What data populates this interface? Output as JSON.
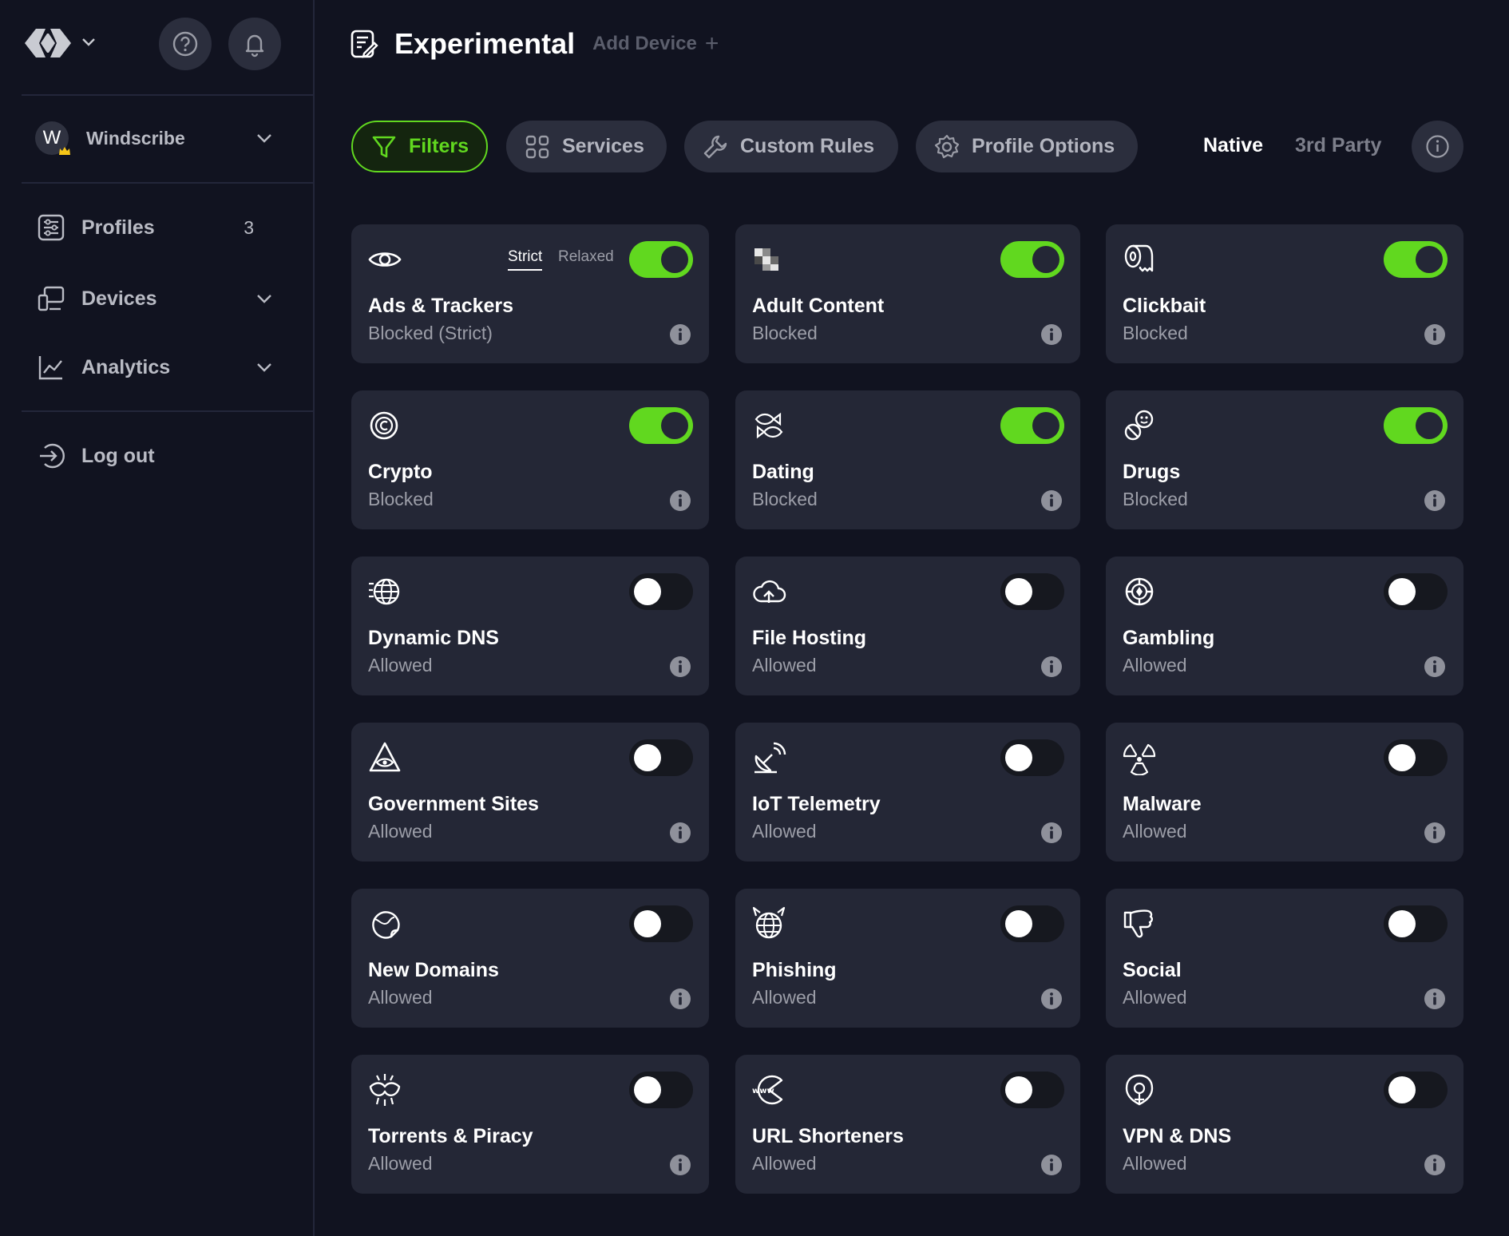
{
  "header": {
    "title": "Experimental",
    "add_device_label": "Add Device",
    "add_device_plus": "+"
  },
  "sidebar": {
    "account": {
      "initial": "W",
      "name": "Windscribe"
    },
    "items": [
      {
        "label": "Profiles",
        "count": "3",
        "icon": "sliders-icon"
      },
      {
        "label": "Devices",
        "icon": "devices-icon"
      },
      {
        "label": "Analytics",
        "icon": "chart-icon"
      }
    ],
    "logout_label": "Log out"
  },
  "tabs": [
    {
      "label": "Filters",
      "icon": "filter-icon",
      "active": true
    },
    {
      "label": "Services",
      "icon": "grid-icon",
      "active": false
    },
    {
      "label": "Custom Rules",
      "icon": "wrench-icon",
      "active": false
    },
    {
      "label": "Profile Options",
      "icon": "gear-icon",
      "active": false
    }
  ],
  "mode": {
    "native": "Native",
    "third_party": "3rd Party",
    "selected": "Native"
  },
  "strictness": {
    "strict": "Strict",
    "relaxed": "Relaxed",
    "selected": "Strict"
  },
  "filters": [
    {
      "title": "Ads & Trackers",
      "status": "Blocked (Strict)",
      "enabled": true,
      "icon": "eye-icon"
    },
    {
      "title": "Adult Content",
      "status": "Blocked",
      "enabled": true,
      "icon": "pixelated-icon"
    },
    {
      "title": "Clickbait",
      "status": "Blocked",
      "enabled": true,
      "icon": "toilet-paper-icon"
    },
    {
      "title": "Crypto",
      "status": "Blocked",
      "enabled": true,
      "icon": "coin-icon"
    },
    {
      "title": "Dating",
      "status": "Blocked",
      "enabled": true,
      "icon": "fish-icon"
    },
    {
      "title": "Drugs",
      "status": "Blocked",
      "enabled": true,
      "icon": "pills-icon"
    },
    {
      "title": "Dynamic DNS",
      "status": "Allowed",
      "enabled": false,
      "icon": "fast-globe-icon"
    },
    {
      "title": "File Hosting",
      "status": "Allowed",
      "enabled": false,
      "icon": "cloud-upload-icon"
    },
    {
      "title": "Gambling",
      "status": "Allowed",
      "enabled": false,
      "icon": "casino-chip-icon"
    },
    {
      "title": "Government Sites",
      "status": "Allowed",
      "enabled": false,
      "icon": "all-seeing-eye-icon"
    },
    {
      "title": "IoT Telemetry",
      "status": "Allowed",
      "enabled": false,
      "icon": "satellite-dish-icon"
    },
    {
      "title": "Malware",
      "status": "Allowed",
      "enabled": false,
      "icon": "radiation-icon"
    },
    {
      "title": "New Domains",
      "status": "Allowed",
      "enabled": false,
      "icon": "globe-sticker-icon"
    },
    {
      "title": "Phishing",
      "status": "Allowed",
      "enabled": false,
      "icon": "devil-globe-icon"
    },
    {
      "title": "Social",
      "status": "Allowed",
      "enabled": false,
      "icon": "thumbs-down-icon"
    },
    {
      "title": "Torrents & Piracy",
      "status": "Allowed",
      "enabled": false,
      "icon": "eyepatch-icon"
    },
    {
      "title": "URL Shorteners",
      "status": "Allowed",
      "enabled": false,
      "icon": "www-pacman-icon"
    },
    {
      "title": "VPN & DNS",
      "status": "Allowed",
      "enabled": false,
      "icon": "shield-pin-icon"
    }
  ],
  "colors": {
    "accent": "#61d81f",
    "background": "#111320",
    "card": "#242736"
  }
}
